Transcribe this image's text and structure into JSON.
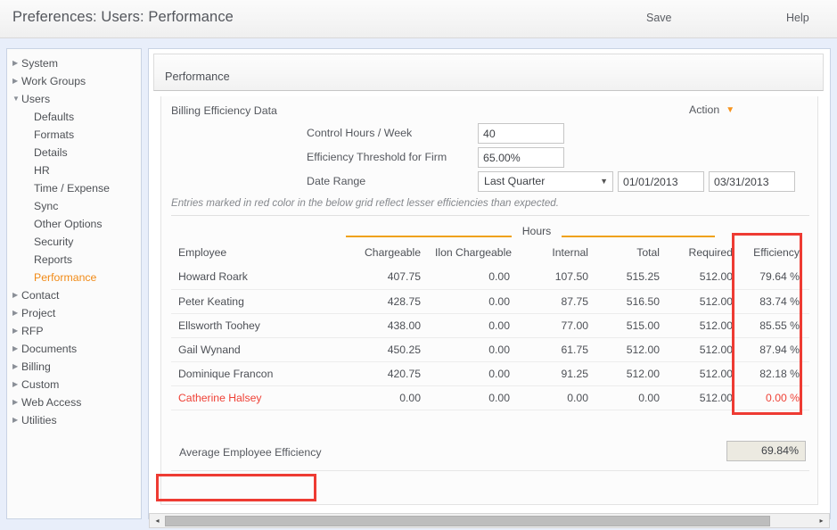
{
  "window": {
    "title": "Preferences: Users: Performance",
    "save_label": "Save",
    "help_label": "Help"
  },
  "sidebar": {
    "items": [
      {
        "label": "System",
        "level": "top",
        "expanded": false,
        "selected": false
      },
      {
        "label": "Work Groups",
        "level": "top",
        "expanded": false,
        "selected": false
      },
      {
        "label": "Users",
        "level": "top",
        "expanded": true,
        "selected": false
      },
      {
        "label": "Defaults",
        "level": "child",
        "selected": false
      },
      {
        "label": "Formats",
        "level": "child",
        "selected": false
      },
      {
        "label": "Details",
        "level": "child",
        "selected": false
      },
      {
        "label": "HR",
        "level": "child",
        "selected": false
      },
      {
        "label": "Time / Expense",
        "level": "child",
        "selected": false
      },
      {
        "label": "Sync",
        "level": "child",
        "selected": false
      },
      {
        "label": "Other Options",
        "level": "child",
        "selected": false
      },
      {
        "label": "Security",
        "level": "child",
        "selected": false
      },
      {
        "label": "Reports",
        "level": "child",
        "selected": false
      },
      {
        "label": "Performance",
        "level": "child",
        "selected": true
      },
      {
        "label": "Contact",
        "level": "top",
        "expanded": false,
        "selected": false
      },
      {
        "label": "Project",
        "level": "top",
        "expanded": false,
        "selected": false
      },
      {
        "label": "RFP",
        "level": "top",
        "expanded": false,
        "selected": false
      },
      {
        "label": "Documents",
        "level": "top",
        "expanded": false,
        "selected": false
      },
      {
        "label": "Billing",
        "level": "top",
        "expanded": false,
        "selected": false
      },
      {
        "label": "Custom",
        "level": "top",
        "expanded": false,
        "selected": false
      },
      {
        "label": "Web Access",
        "level": "top",
        "expanded": false,
        "selected": false
      },
      {
        "label": "Utilities",
        "level": "top",
        "expanded": false,
        "selected": false
      }
    ]
  },
  "tabs": [
    {
      "label": "Performance",
      "active": true
    }
  ],
  "panel": {
    "section_title": "Billing Efficiency Data",
    "action_label": "Action",
    "note": "Entries marked in red color in the below grid reflect lesser efficiencies than expected.",
    "form": {
      "control_hours_label": "Control Hours / Week",
      "control_hours_value": "40",
      "efficiency_threshold_label": "Efficiency Threshold for Firm",
      "efficiency_threshold_value": "65.00%",
      "date_range_label": "Date Range",
      "date_range_value": "Last Quarter",
      "date_range_options": [
        "Last Quarter"
      ],
      "date_from_value": "01/01/2013",
      "date_to_value": "03/31/2013"
    }
  },
  "grid": {
    "group_header": "Hours",
    "columns": [
      "Employee",
      "Chargeable",
      "Ilon Chargeable",
      "Internal",
      "Total",
      "Required",
      "Efficiency"
    ],
    "rows": [
      {
        "employee": "Howard Roark",
        "chargeable": "407.75",
        "non_chargeable": "0.00",
        "internal": "107.50",
        "total": "515.25",
        "required": "512.00",
        "efficiency": "79.64 %",
        "alert": false
      },
      {
        "employee": "Peter Keating",
        "chargeable": "428.75",
        "non_chargeable": "0.00",
        "internal": "87.75",
        "total": "516.50",
        "required": "512.00",
        "efficiency": "83.74 %",
        "alert": false
      },
      {
        "employee": "Ellsworth Toohey",
        "chargeable": "438.00",
        "non_chargeable": "0.00",
        "internal": "77.00",
        "total": "515.00",
        "required": "512.00",
        "efficiency": "85.55 %",
        "alert": false
      },
      {
        "employee": "Gail Wynand",
        "chargeable": "450.25",
        "non_chargeable": "0.00",
        "internal": "61.75",
        "total": "512.00",
        "required": "512.00",
        "efficiency": "87.94 %",
        "alert": false
      },
      {
        "employee": "Dominique Francon",
        "chargeable": "420.75",
        "non_chargeable": "0.00",
        "internal": "91.25",
        "total": "512.00",
        "required": "512.00",
        "efficiency": "82.18 %",
        "alert": false
      },
      {
        "employee": "Catherine Halsey",
        "chargeable": "0.00",
        "non_chargeable": "0.00",
        "internal": "0.00",
        "total": "0.00",
        "required": "512.00",
        "efficiency": "0.00 %",
        "alert": true
      }
    ]
  },
  "summary": {
    "label": "Average Employee Efficiency",
    "value": "69.84%"
  },
  "scrollbar": {
    "left_arrow": "◂",
    "right_arrow": "▸"
  },
  "colors": {
    "accent_orange": "#f0a217",
    "selected_nav": "#f18a16",
    "alert_red": "#ef4136",
    "annotation_red": "#ee3b33",
    "page_bg": "#e8eefa"
  }
}
